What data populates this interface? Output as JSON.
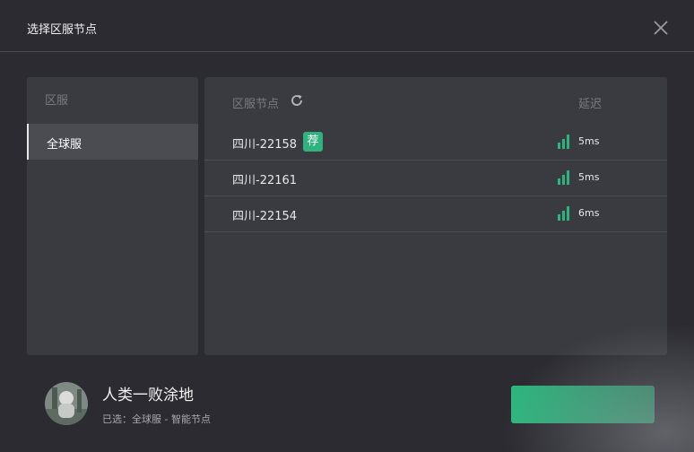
{
  "dialog": {
    "title": "选择区服节点",
    "close_icon": "close-icon"
  },
  "regions": {
    "header": "区服",
    "items": [
      {
        "label": "全球服",
        "selected": true
      }
    ]
  },
  "nodes": {
    "header": "区服节点",
    "refresh_icon": "refresh-icon",
    "latency_header": "延迟",
    "recommended_badge": "荐",
    "signal_color": "#2fb37e",
    "rows": [
      {
        "name": "四川-22158",
        "latency": "5ms",
        "recommended": true
      },
      {
        "name": "四川-22161",
        "latency": "5ms",
        "recommended": false
      },
      {
        "name": "四川-22154",
        "latency": "6ms",
        "recommended": false
      }
    ]
  },
  "user": {
    "name": "人类一败涂地",
    "selected_text": "已选：全球服 - 智能节点"
  },
  "colors": {
    "accent": "#2fb37e",
    "background": "#2b2b31",
    "panel": "#3a3a41"
  }
}
